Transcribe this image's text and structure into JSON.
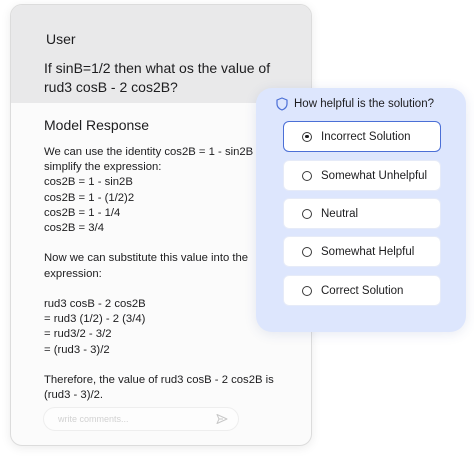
{
  "chat": {
    "user_title": "User",
    "user_question": "If sinB=1/2 then what os the value of rud3 cosB - 2 cos2B?",
    "model_title": "Model Response",
    "model_response": "We can use the identity cos2B = 1 - sin2B to simplify the expression:\ncos2B = 1 - sin2B\ncos2B = 1 - (1/2)2\ncos2B = 1 - 1/4\ncos2B = 3/4\n\nNow we can substitute this value into the expression:\n\nrud3 cosB - 2 cos2B\n= rud3 (1/2) - 2 (3/4)\n= rud3/2 - 3/2\n= (rud3 - 3)/2\n\nTherefore, the value of rud3 cosB - 2 cos2B is (rud3 - 3)/2.",
    "comment_placeholder": "write comments..."
  },
  "rating": {
    "title": "How helpful is the solution?",
    "options": [
      {
        "label": "Incorrect Solution",
        "selected": true
      },
      {
        "label": "Somewhat Unhelpful",
        "selected": false
      },
      {
        "label": "Neutral",
        "selected": false
      },
      {
        "label": "Somewhat Helpful",
        "selected": false
      },
      {
        "label": "Correct Solution",
        "selected": false
      }
    ]
  },
  "icons": {
    "header": "shield-icon",
    "comment_submit": "send-icon"
  },
  "colors": {
    "panel_bg": "#dde6fd",
    "selected_border": "#4b6fd6",
    "user_block_bg": "#e9e9ea"
  }
}
